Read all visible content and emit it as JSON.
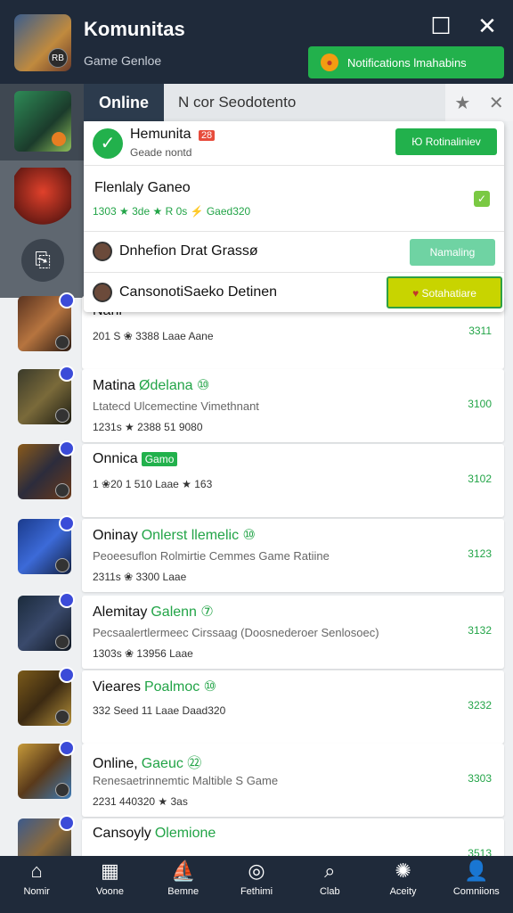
{
  "header": {
    "title": "Komunitas",
    "subtitle": "Game Genloe",
    "avatar_badge": "RB",
    "notif_label": "Notifications lmahabins"
  },
  "tabs": {
    "online": "Online",
    "second": "N cor Seodotento"
  },
  "popup": {
    "row1": {
      "title": "Hemunita",
      "badge": "28",
      "sub": "Geade nontd",
      "button": "Ю Rotinaliniev"
    },
    "row2": {
      "title": "Flenlaly Ganeo",
      "meta": "1303 ★ 3de ★ R 0s ⚡ Gaed320"
    },
    "row3": {
      "title": "Dnhefion Drat Grassø",
      "button": "Namaling"
    },
    "row4": {
      "title": "CansonotiSaeko Detinen",
      "button": "Sotahatiare"
    }
  },
  "list": [
    {
      "title": "Nanl",
      "tag": "",
      "desc": "",
      "meta": "201 S  ❀ 3388  Laae  Aane",
      "num": "3311"
    },
    {
      "title": "Matina",
      "tag": "Ødelana ⑩",
      "desc": "Ltatecd Ulcemectine Vimethnant",
      "meta": "1231s ★ 2388  51 9080",
      "num": "3100"
    },
    {
      "title": "Onnica",
      "tag": "Gamo",
      "desc": "",
      "meta": "1  ❀20 1 510  Laae  ★ 163",
      "num": "3102"
    },
    {
      "title": "Oninay",
      "tag": "Onlerst llemelic ⑩",
      "desc": "Peoeesuflon Rolmirtie Cemmes Game Ratiine",
      "meta": "2311s ❀ 3300  Laae",
      "num": "3123"
    },
    {
      "title": "Alemitay",
      "tag": "Galenn ⑦",
      "desc": "Pecsaalertlermeec Cirssaag (Doosnederoer Senlosoec)",
      "meta": "1303s ❀ 13956  Laae",
      "num": "3132"
    },
    {
      "title": "Vieares",
      "tag": "Poalmoc ⑩",
      "desc": "",
      "meta": "332  Seed 11  Laae  Daad320",
      "num": "3232"
    },
    {
      "title": "Online,",
      "tag": "Gaeuc ㉒",
      "desc": "Renesaetrinnemtic Maltible S Game",
      "meta": "2231  440320  ★ 3as",
      "num": "3303"
    },
    {
      "title": "Cansoyly",
      "tag": "Olemione",
      "desc": "",
      "meta": "",
      "num": "3513"
    }
  ],
  "nav": [
    {
      "label": "Nomir",
      "icon": "home-icon",
      "glyph": "⌂"
    },
    {
      "label": "Voone",
      "icon": "grid-icon",
      "glyph": "▦"
    },
    {
      "label": "Bemne",
      "icon": "boat-icon",
      "glyph": "⛵"
    },
    {
      "label": "Fethimi",
      "icon": "target-icon",
      "glyph": "◎"
    },
    {
      "label": "Clab",
      "icon": "search-icon",
      "glyph": "⌕"
    },
    {
      "label": "Aceity",
      "icon": "activity-icon",
      "glyph": "✺"
    },
    {
      "label": "Comniions",
      "icon": "person-icon",
      "glyph": "👤"
    }
  ],
  "colors": {
    "header_bg": "#1f2a3a",
    "accent_green": "#22b14c",
    "highlight_yellow": "#c8d400"
  }
}
